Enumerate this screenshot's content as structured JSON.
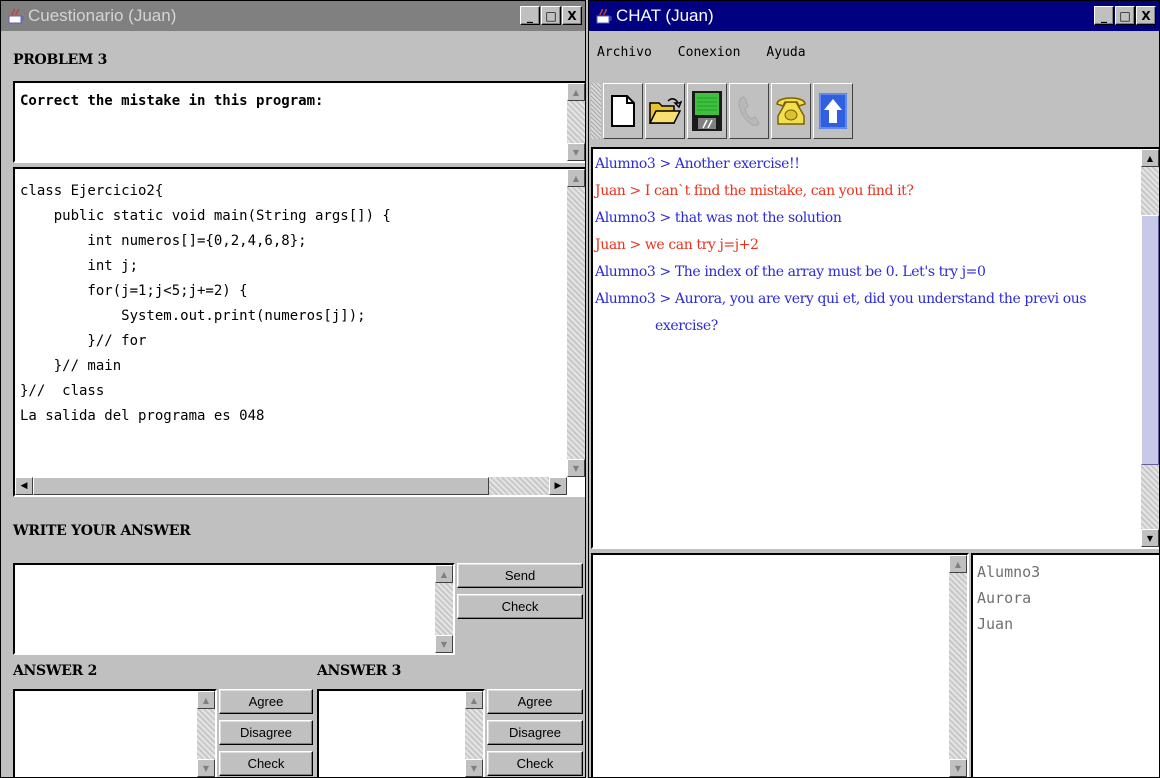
{
  "left_window": {
    "title": "Cuestionario (Juan)",
    "controls": {
      "min": "_",
      "max": "□",
      "close": "X"
    },
    "problem_label": "PROBLEM 3",
    "instruction": "Correct the mistake in this program:",
    "code": "class Ejercicio2{\n    public static void main(String args[]) {\n        int numeros[]={0,2,4,6,8};\n        int j;\n        for(j=1;j<5;j+=2) {\n            System.out.print(numeros[j]);\n        }// for\n    }// main\n}//  class\nLa salida del programa es 048",
    "answer_label": "WRITE YOUR ANSWER",
    "send_label": "Send",
    "check_label": "Check",
    "answer2_label": "ANSWER 2",
    "answer3_label": "ANSWER 3",
    "agree_label": "Agree",
    "disagree_label": "Disagree"
  },
  "right_window": {
    "title": "CHAT (Juan)",
    "controls": {
      "min": "_",
      "max": "□",
      "close": "X"
    },
    "menu": [
      "Archivo",
      "Conexion",
      "Ayuda"
    ],
    "toolbar_icons": [
      "new-file-icon",
      "open-folder-icon",
      "save-icon",
      "phone-disabled-icon",
      "phone-icon",
      "upload-icon"
    ],
    "messages": [
      {
        "text": "Alumno3 > Another exercise!!",
        "color": "#2a2ad8"
      },
      {
        "text": "Juan > I can`t find the mistake, can you find it?",
        "color": "#e8321c"
      },
      {
        "text": "Alumno3 > that was not the solution",
        "color": "#2a2ad8"
      },
      {
        "text": "Juan > we can try j=j+2",
        "color": "#e8321c"
      },
      {
        "text": "Alumno3 > The index of the array must be  0. Let's try j=0",
        "color": "#2a2ad8"
      },
      {
        "text": "Alumno3 > Aurora, you are very qui et, did you understand the previ ous",
        "continuation": "exercise?",
        "color": "#2a2ad8"
      }
    ],
    "users": [
      "Alumno3",
      "Aurora",
      "Juan"
    ]
  }
}
